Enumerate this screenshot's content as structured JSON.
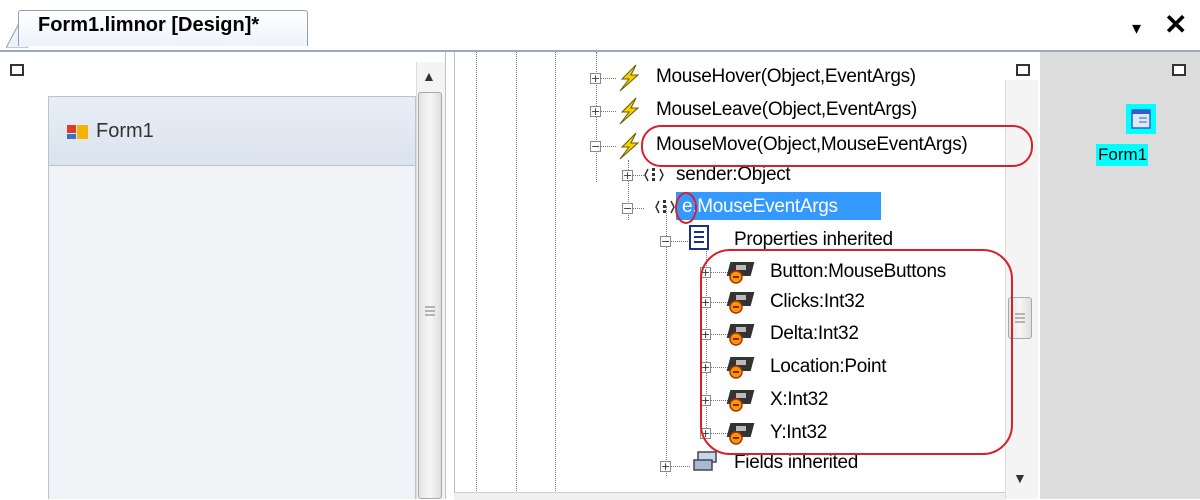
{
  "document_tab": {
    "label": "Form1.limnor [Design]*"
  },
  "tab_controls": {
    "dropdown_glyph": "▾",
    "close_glyph": "✕"
  },
  "designer": {
    "form_item_label": "Form1",
    "form_icon": "form-icon"
  },
  "tree": {
    "nodes": [
      {
        "label": "MouseHover(Object,EventArgs)",
        "icon": "event-lightning-icon",
        "expander": "+"
      },
      {
        "label": "MouseLeave(Object,EventArgs)",
        "icon": "event-lightning-icon",
        "expander": "+"
      },
      {
        "label": "MouseMove(Object,MouseEventArgs)",
        "icon": "event-lightning-icon",
        "expander": "−"
      },
      {
        "label": "sender:Object",
        "icon": "parameter-icon",
        "expander": "+"
      },
      {
        "label": "e:MouseEventArgs",
        "icon": "parameter-icon",
        "expander": "−",
        "selected": true
      },
      {
        "label": "Properties inherited",
        "icon": "properties-page-icon",
        "expander": "−"
      },
      {
        "label": "Button:MouseButtons",
        "icon": "property-icon",
        "expander": "+"
      },
      {
        "label": "Clicks:Int32",
        "icon": "property-icon",
        "expander": "+"
      },
      {
        "label": "Delta:Int32",
        "icon": "property-icon",
        "expander": "+"
      },
      {
        "label": "Location:Point",
        "icon": "property-icon",
        "expander": "+"
      },
      {
        "label": "X:Int32",
        "icon": "property-icon",
        "expander": "+"
      },
      {
        "label": "Y:Int32",
        "icon": "property-icon",
        "expander": "+"
      },
      {
        "label": "Fields inherited",
        "icon": "fields-icon",
        "expander": "+"
      }
    ]
  },
  "component_tray": {
    "label": "Form1",
    "icon": "form-component-icon"
  },
  "colors": {
    "selection": "#3399ff",
    "annotation": "#d9202a",
    "component_highlight": "#00ffff",
    "lightning": "#f5d000"
  }
}
